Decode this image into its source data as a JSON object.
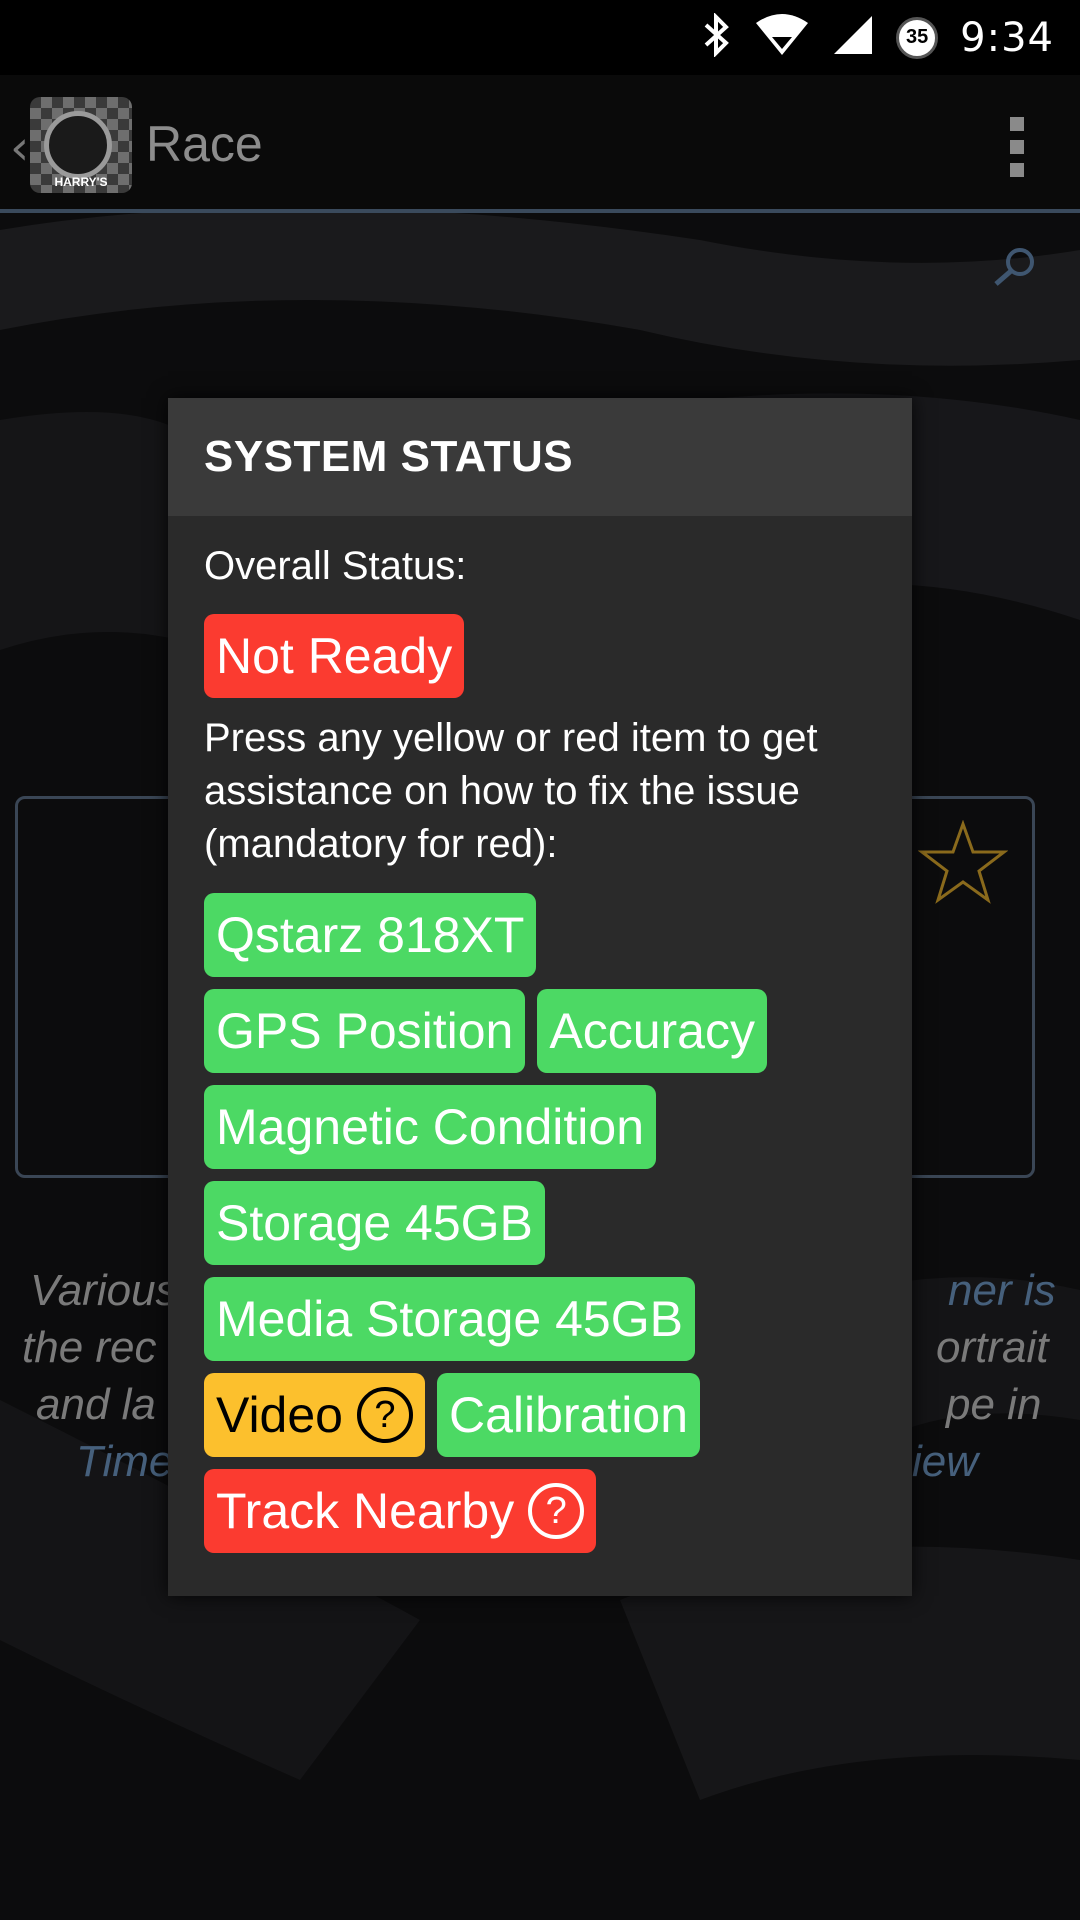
{
  "status_bar": {
    "time": "9:34",
    "notification_badge": "35"
  },
  "app_bar": {
    "title": "Race",
    "logo_text": "HARRY'S"
  },
  "background": {
    "text_lines": [
      {
        "left": "Various",
        "right": "ner is"
      },
      {
        "left": "the rec",
        "right": "ortrait"
      },
      {
        "left": "and la",
        "right": "pe in"
      },
      {
        "left": "Time",
        "right": "iew"
      }
    ]
  },
  "dialog": {
    "title": "SYSTEM STATUS",
    "overall_label": "Overall Status:",
    "overall_value": "Not Ready",
    "description": "Press any yellow or red item to get assistance on how to fix the issue (mandatory for red):",
    "items": [
      {
        "label": "Qstarz 818XT",
        "status": "green"
      },
      {
        "label": "GPS Position",
        "status": "green"
      },
      {
        "label": "Accuracy",
        "status": "green"
      },
      {
        "label": "Magnetic Condition",
        "status": "green"
      },
      {
        "label": "Storage 45GB",
        "status": "green"
      },
      {
        "label": "Media Storage 45GB",
        "status": "green"
      },
      {
        "label": "Video",
        "status": "yellow",
        "help": "?"
      },
      {
        "label": "Calibration",
        "status": "green"
      },
      {
        "label": "Track Nearby",
        "status": "red",
        "help": "?"
      }
    ]
  },
  "colors": {
    "green": "#4cd964",
    "yellow": "#fcc02d",
    "red": "#fb3b30",
    "appbar_divider": "#3a4a5c"
  }
}
